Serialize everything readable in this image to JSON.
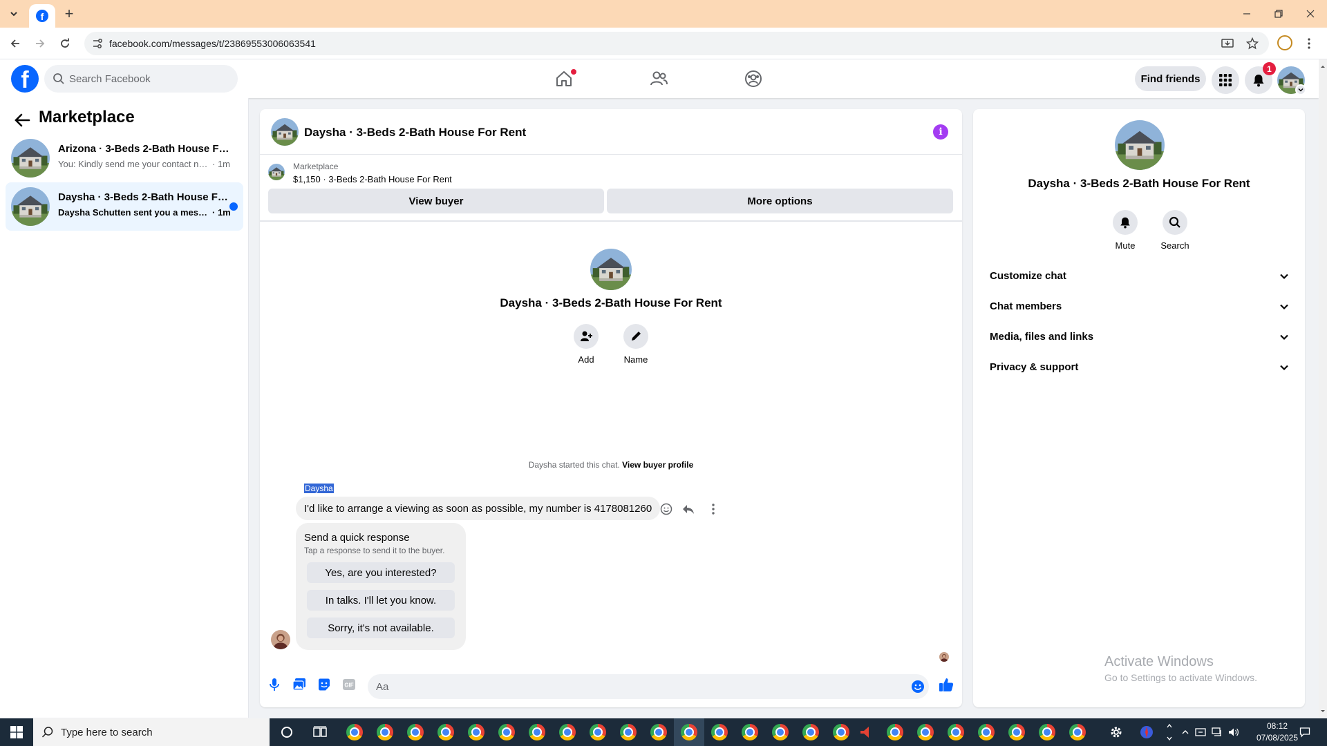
{
  "browser": {
    "url": "facebook.com/messages/t/23869553006063541"
  },
  "fb_nav": {
    "search_placeholder": "Search Facebook",
    "find_friends": "Find friends",
    "notification_count": "1"
  },
  "sidebar": {
    "title": "Marketplace",
    "conversations": [
      {
        "title": "Arizona · 3-Beds 2-Bath House For Rent",
        "preview": "You: Kindly send me your contact number",
        "time": "· 1m",
        "active": false,
        "unread": false
      },
      {
        "title": "Daysha · 3-Beds 2-Bath House For Rent",
        "preview": "Daysha Schutten sent you a message",
        "time": "· 1m",
        "active": true,
        "unread": true
      }
    ]
  },
  "chat": {
    "title": "Daysha · 3-Beds 2-Bath House For Rent",
    "listing": {
      "category": "Marketplace",
      "item": "$1,150 · 3-Beds 2-Bath House For Rent"
    },
    "view_buyer": "View buyer",
    "more_options": "More options",
    "intro_title": "Daysha · 3-Beds 2-Bath House For Rent",
    "intro_actions": {
      "add": "Add",
      "name": "Name"
    },
    "started_text": "Daysha started this chat.",
    "view_buyer_profile": "View buyer profile",
    "sender_name": "Daysha",
    "message": "I'd like to arrange a viewing as soon as possible, my number is 4178081260",
    "quick_response": {
      "title": "Send a quick response",
      "subtitle": "Tap a response to send it to the buyer.",
      "options": [
        "Yes, are you interested?",
        "In talks. I'll let you know.",
        "Sorry, it's not available."
      ]
    },
    "composer_placeholder": "Aa"
  },
  "details": {
    "title": "Daysha · 3-Beds 2-Bath House For Rent",
    "mute": "Mute",
    "search": "Search",
    "sections": [
      "Customize chat",
      "Chat members",
      "Media, files and links",
      "Privacy & support"
    ]
  },
  "watermark": {
    "line1": "Activate Windows",
    "line2": "Go to Settings to activate Windows."
  },
  "taskbar": {
    "search_placeholder": "Type here to search",
    "time": "08:12",
    "date": "07/08/2025"
  },
  "colors": {
    "facebook_blue": "#0866ff",
    "tab_bar": "#fcd9b6",
    "taskbar": "#1c2b3a",
    "info_purple": "#a33cf2"
  }
}
